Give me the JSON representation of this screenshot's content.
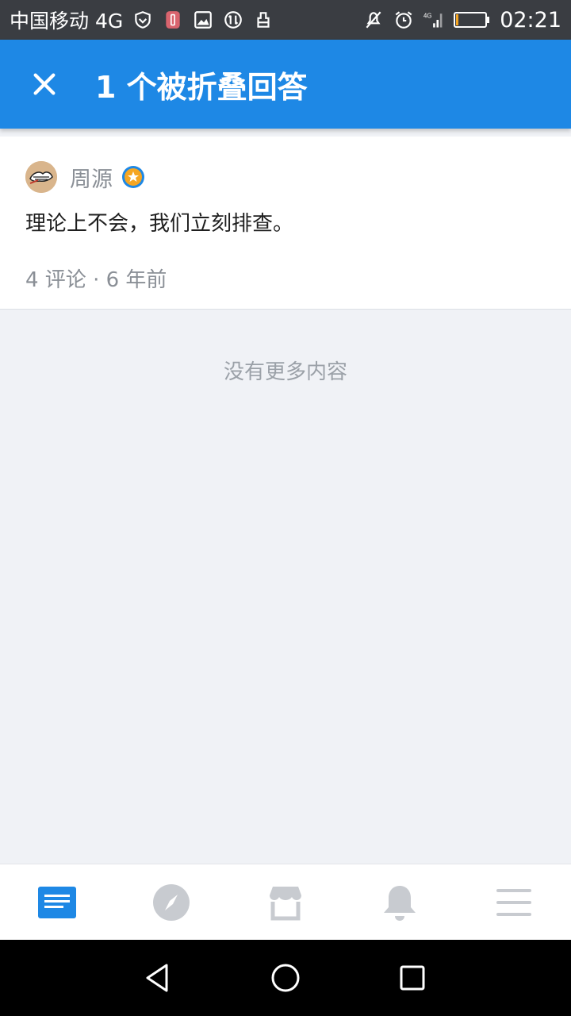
{
  "status_bar": {
    "carrier": "中国移动 4G",
    "time": "02:21",
    "network_tag": "4G"
  },
  "appbar": {
    "title": "1 个被折叠回答"
  },
  "answer": {
    "author": "周源",
    "text": "理论上不会，我们立刻排查。",
    "meta": "4 评论 · 6 年前"
  },
  "list_end_text": "没有更多内容",
  "bottom_nav": {
    "items": [
      {
        "icon": "feed-icon",
        "active": true
      },
      {
        "icon": "compass-icon",
        "active": false
      },
      {
        "icon": "store-icon",
        "active": false
      },
      {
        "icon": "bell-icon",
        "active": false
      },
      {
        "icon": "menu-icon",
        "active": false
      }
    ]
  },
  "colors": {
    "primary": "#1e88e5",
    "inactive_icon": "#c8cbd0",
    "badge": "#f5a623"
  }
}
